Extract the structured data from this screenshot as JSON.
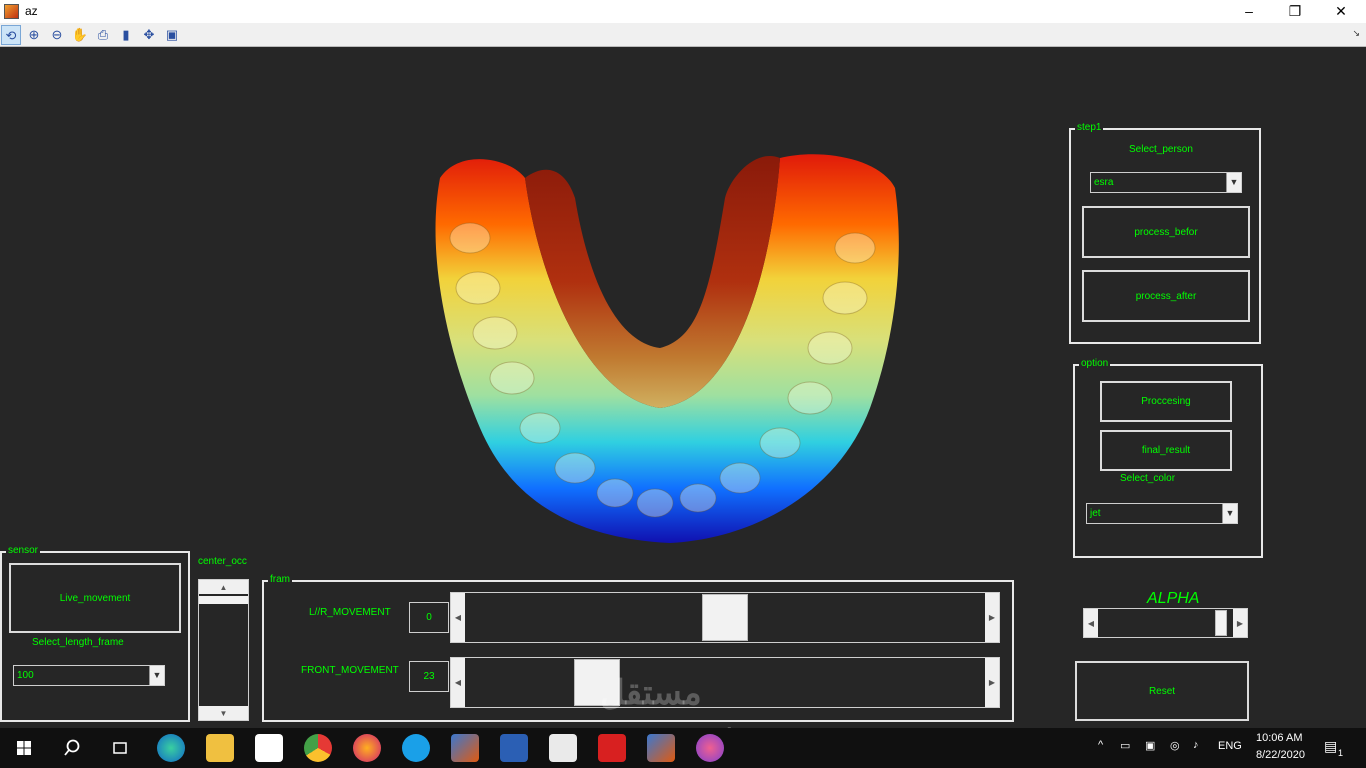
{
  "window": {
    "title": "az",
    "controls": [
      "–",
      "❐",
      "✕"
    ]
  },
  "toolbar": {
    "icons": [
      "rotate-icon",
      "zoom-in-icon",
      "zoom-out-icon",
      "pan-icon",
      "print-icon",
      "figure-icon",
      "data-cursor-icon",
      "save-icon"
    ],
    "glyphs": [
      "⟲",
      "⊕",
      "⊖",
      "✋",
      "⎙",
      "▮",
      "✥",
      "▣"
    ],
    "dock_glyph": "↘"
  },
  "step1": {
    "title": "step1",
    "select_label": "Select_person",
    "person_value": "esra",
    "btn_before": "process_befor",
    "btn_after": "process_after"
  },
  "option": {
    "title": "option",
    "btn_processing": "Proccesing",
    "btn_final": "final_result",
    "color_label": "Select_color",
    "color_value": "jet"
  },
  "alpha": {
    "title": "ALPHA",
    "value": 0.95
  },
  "reset": {
    "label": "Reset"
  },
  "sensor": {
    "title": "sensor",
    "btn_live": "Live_movement",
    "length_label": "Select_length_frame",
    "length_value": "100"
  },
  "center_occ": {
    "label": "center_occ"
  },
  "fram": {
    "title": "fram",
    "lr_label": "L//R_MOVEMENT",
    "lr_value": "0",
    "lr_slider": 0.5,
    "front_label": "FRONT_MOVEMENT",
    "front_value": "23",
    "front_slider": 0.23
  },
  "taskbar": {
    "apps": [
      "windows-start-icon",
      "search-icon",
      "task-view-icon",
      "edge-icon",
      "file-explorer-icon",
      "mail-icon",
      "chrome-icon",
      "firefox-icon",
      "skype-icon",
      "matlab-icon",
      "word-icon",
      "photos-icon",
      "acrobat-icon",
      "matlab-icon-2",
      "paint3d-icon"
    ],
    "lang": "ENG",
    "time": "10:06 AM",
    "date": "8/22/2020",
    "notif_count": "1"
  },
  "watermark": {
    "arabic": "مستقل",
    "latin": "mostaql.com"
  },
  "colors": {
    "label_green": "#00ff00",
    "background": "#262626"
  }
}
